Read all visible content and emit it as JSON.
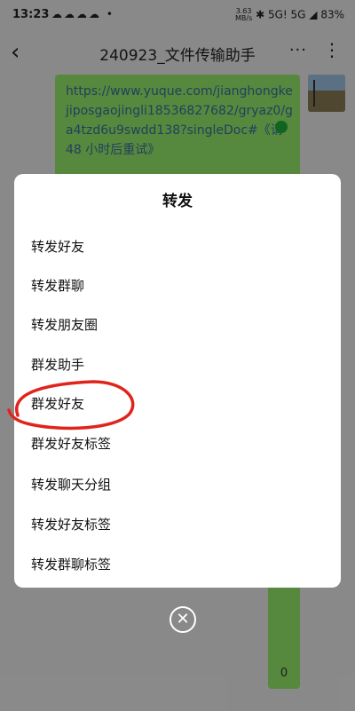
{
  "status_bar": {
    "time": "13:23",
    "app_icons": "☁☁☁☁ •",
    "net_speed_value": "3.63",
    "net_speed_unit": "MB/s",
    "signal_labels": "5G! 5G",
    "battery": "83%"
  },
  "header": {
    "back_icon": "‹",
    "title": "240923_文件传输助手",
    "more_icon": "···",
    "menu_icon": "⋮"
  },
  "chat": {
    "message_text": "https://www.yuque.com/jianghongkejiposgaojingli18536827682/gryaz0/ga4tzd6u9swdd138?singleDoc#《请 48 小时后重试》",
    "last_message_text": "0"
  },
  "forward_sheet": {
    "title": "转发",
    "items": [
      "转发好友",
      "转发群聊",
      "转发朋友圈",
      "群发助手",
      "群发好友",
      "群发好友标签",
      "转发聊天分组",
      "转发好友标签",
      "转发群聊标签"
    ]
  },
  "close_icon": "✕",
  "annotation_color": "#e0241b"
}
